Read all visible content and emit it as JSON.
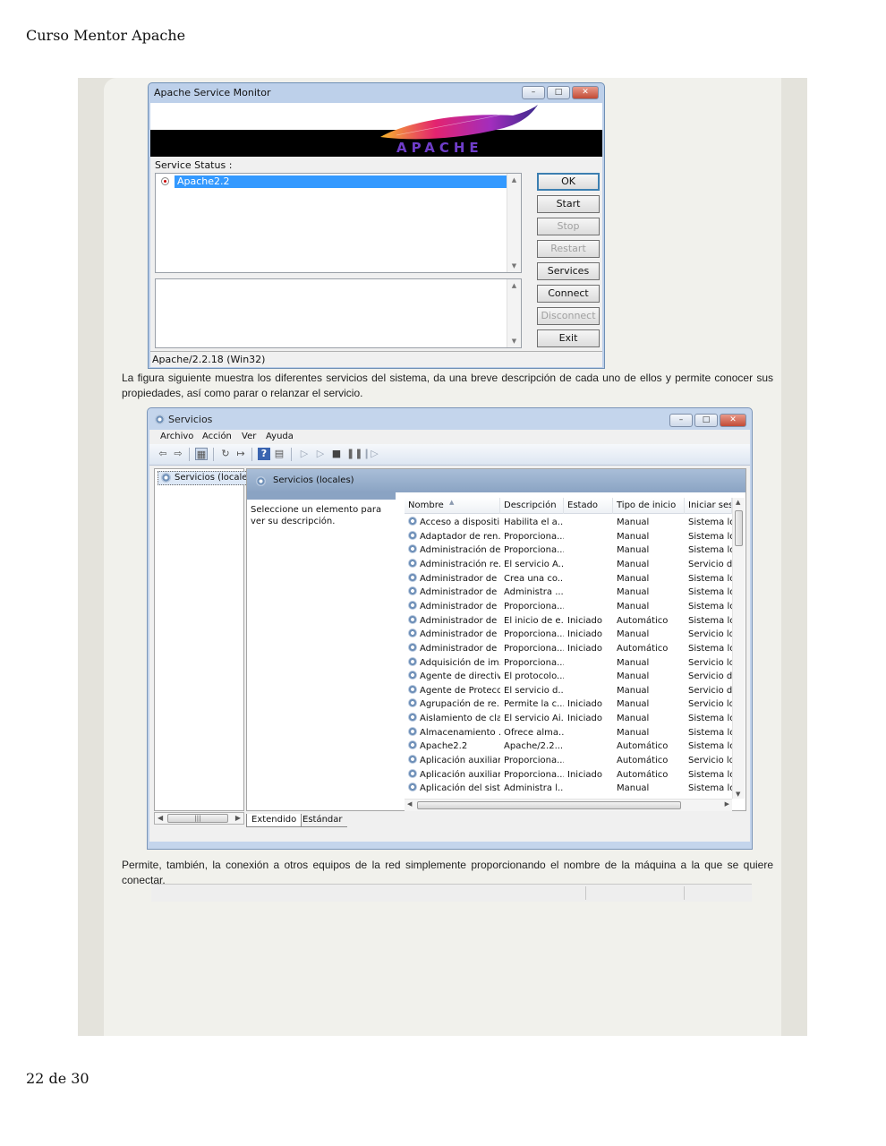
{
  "header": {
    "title": "Curso Mentor Apache"
  },
  "footer": {
    "page": "22 de 30"
  },
  "paragraphs": [
    "La figura siguiente muestra los diferentes servicios del sistema, da una breve descripción de cada uno de ellos y permite conocer sus propiedades, así como parar o relanzar el servicio.",
    "Permite, también, la conexión a otros equipos de la red simplemente proporcionando el nombre de la máquina a la que se quiere conectar."
  ],
  "apache_monitor": {
    "title": "Apache Service Monitor",
    "logo_text": "APACHE",
    "service_status_label": "Service Status :",
    "services": [
      "Apache2.2"
    ],
    "buttons": {
      "ok": "OK",
      "start": "Start",
      "stop": "Stop",
      "restart": "Restart",
      "services": "Services",
      "connect": "Connect",
      "disconnect": "Disconnect",
      "exit": "Exit"
    },
    "status_bar": "Apache/2.2.18 (Win32)"
  },
  "services_window": {
    "title": "Servicios",
    "menu": [
      "Archivo",
      "Acción",
      "Ver",
      "Ayuda"
    ],
    "tree_item": "Servicios (locales)",
    "pane_title": "Servicios (locales)",
    "description_prompt": "Seleccione un elemento para ver su descripción.",
    "columns": [
      "Nombre",
      "Descripción",
      "Estado",
      "Tipo de inicio",
      "Iniciar sesió"
    ],
    "rows": [
      [
        "Acceso a dispositi...",
        "Habilita el a...",
        "",
        "Manual",
        "Sistema loc"
      ],
      [
        "Adaptador de ren...",
        "Proporciona...",
        "",
        "Manual",
        "Sistema loc"
      ],
      [
        "Administración de...",
        "Proporciona...",
        "",
        "Manual",
        "Sistema loc"
      ],
      [
        "Administración re...",
        "El servicio A...",
        "",
        "Manual",
        "Servicio de"
      ],
      [
        "Administrador de ...",
        "Crea una co...",
        "",
        "Manual",
        "Sistema loc"
      ],
      [
        "Administrador de ...",
        "Administra ...",
        "",
        "Manual",
        "Sistema loc"
      ],
      [
        "Administrador de ...",
        "Proporciona...",
        "",
        "Manual",
        "Sistema loc"
      ],
      [
        "Administrador de ...",
        "El inicio de e...",
        "Iniciado",
        "Automático",
        "Sistema loc"
      ],
      [
        "Administrador de ...",
        "Proporciona...",
        "Iniciado",
        "Manual",
        "Servicio loc"
      ],
      [
        "Administrador de ...",
        "Proporciona...",
        "Iniciado",
        "Automático",
        "Sistema loc"
      ],
      [
        "Adquisición de im...",
        "Proporciona...",
        "",
        "Manual",
        "Servicio loc"
      ],
      [
        "Agente de directiv...",
        "El protocolo...",
        "",
        "Manual",
        "Servicio de"
      ],
      [
        "Agente de Protecc...",
        "El servicio d...",
        "",
        "Manual",
        "Servicio de"
      ],
      [
        "Agrupación de re...",
        "Permite la c...",
        "Iniciado",
        "Manual",
        "Servicio loc"
      ],
      [
        "Aislamiento de cla...",
        "El servicio Ai...",
        "Iniciado",
        "Manual",
        "Sistema loc"
      ],
      [
        "Almacenamiento ...",
        "Ofrece alma...",
        "",
        "Manual",
        "Sistema loc"
      ],
      [
        "Apache2.2",
        "Apache/2.2....",
        "",
        "Automático",
        "Sistema loc"
      ],
      [
        "Aplicación auxiliar...",
        "Proporciona...",
        "",
        "Automático",
        "Servicio loc"
      ],
      [
        "Aplicación auxiliar...",
        "Proporciona...",
        "Iniciado",
        "Automático",
        "Sistema loc"
      ],
      [
        "Aplicación del sist...",
        "Administra l...",
        "",
        "Manual",
        "Sistema loc"
      ]
    ],
    "tabs": [
      "Extendido",
      "Estándar"
    ]
  }
}
